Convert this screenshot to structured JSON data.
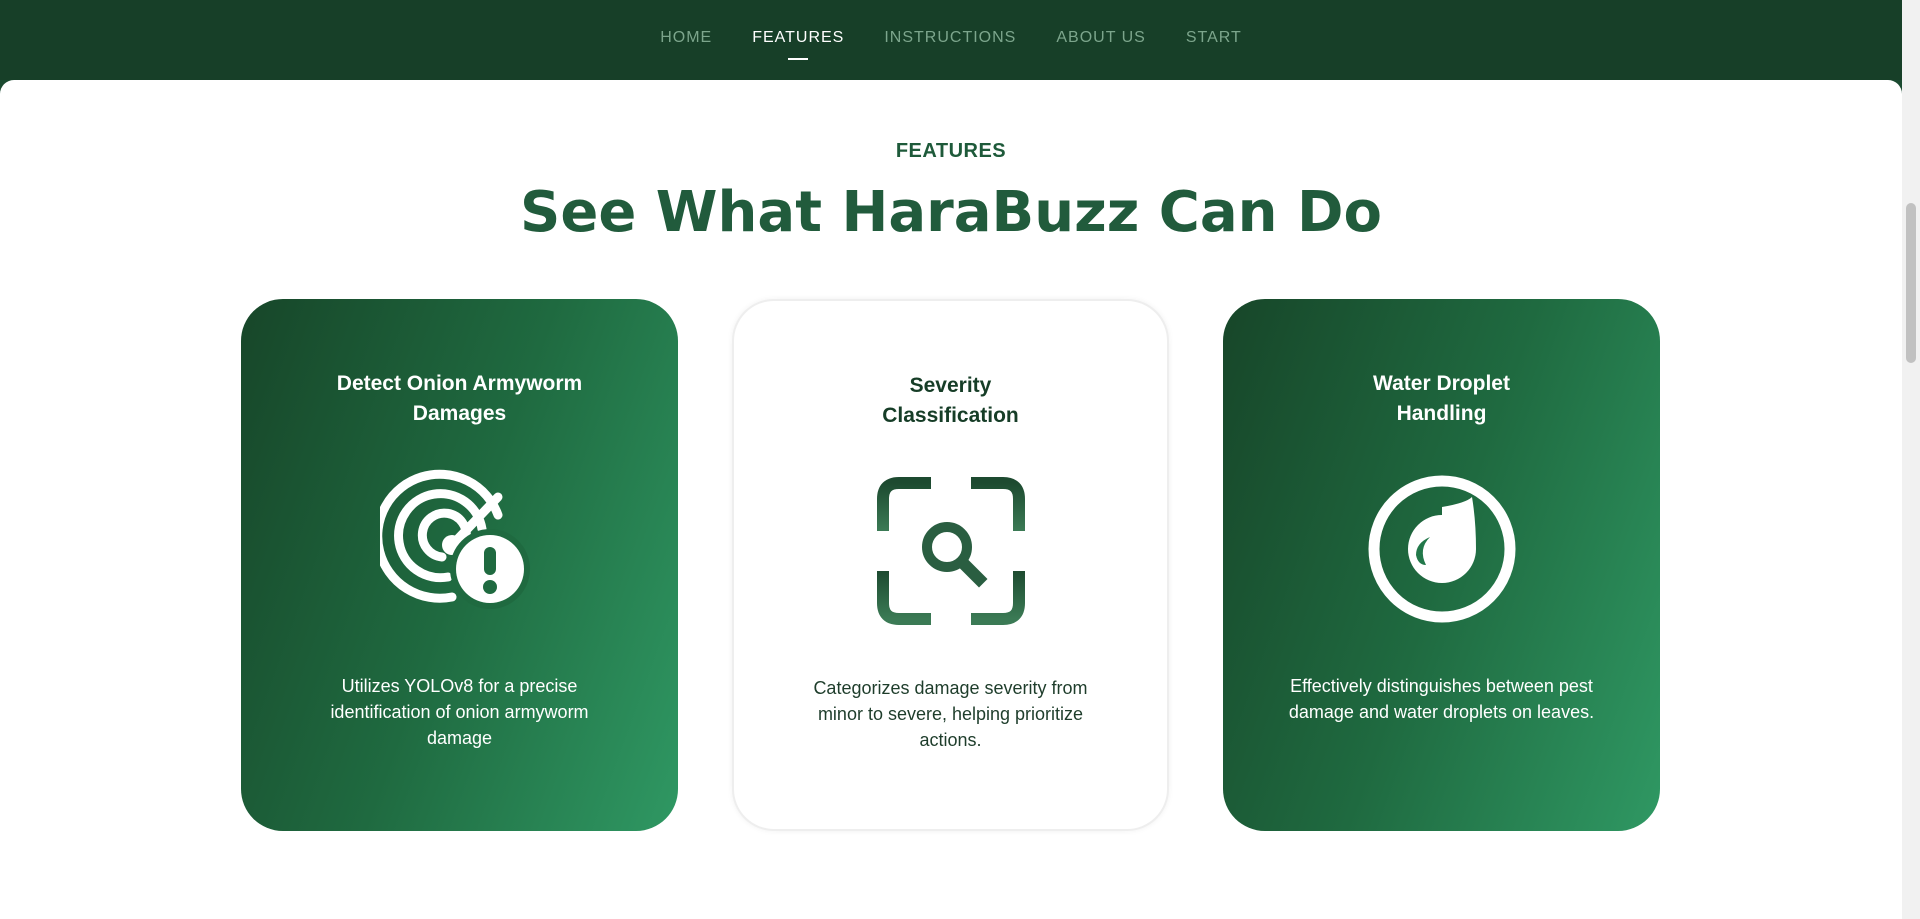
{
  "nav": {
    "items": [
      {
        "label": "HOME",
        "active": false
      },
      {
        "label": "FEATURES",
        "active": true
      },
      {
        "label": "INSTRUCTIONS",
        "active": false
      },
      {
        "label": "ABOUT US",
        "active": false
      },
      {
        "label": "START",
        "active": false
      }
    ]
  },
  "section": {
    "eyebrow": "FEATURES",
    "headline": "See What HaraBuzz Can Do"
  },
  "cards": [
    {
      "title": "Detect Onion Armyworm Damages",
      "icon": "radar-alert-icon",
      "description": "Utilizes YOLOv8 for a precise identification of onion armyworm damage",
      "style": "green"
    },
    {
      "title": "Severity Classification",
      "icon": "scan-search-icon",
      "description": "Categorizes damage severity from minor to severe, helping prioritize actions.",
      "style": "white"
    },
    {
      "title": "Water Droplet Handling",
      "icon": "water-drop-icon",
      "description": "Effectively distinguishes between pest damage and water droplets on leaves.",
      "style": "green"
    }
  ],
  "colors": {
    "nav_bg": "#173f28",
    "nav_inactive": "#7ca58c",
    "heading_green": "#215b3c",
    "card_gradient_start": "#174629",
    "card_gradient_end": "#2f9863"
  }
}
